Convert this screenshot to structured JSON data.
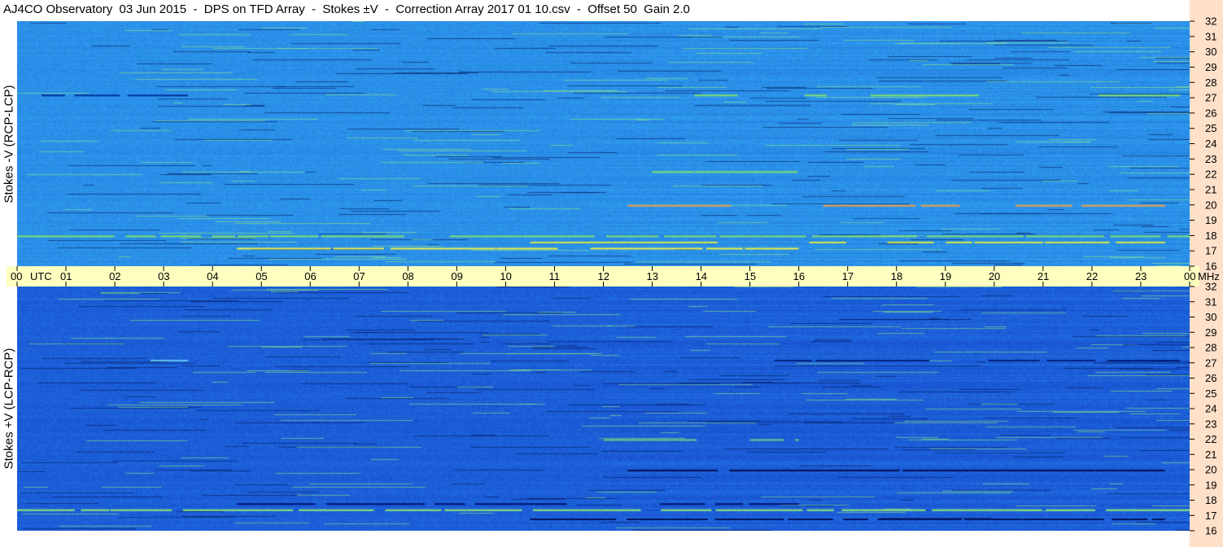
{
  "title": "AJ4CO Observatory  03 Jun 2015  -  DPS on TFD Array  -  Stokes ±V  -  Correction Array 2017 01 10.csv  -  Offset 50  Gain 2.0",
  "chart_data": [
    {
      "type": "heatmap",
      "panel": "top",
      "ylabel": "Stokes -V (RCP-LCP)",
      "x_range_utc_hours": [
        0,
        24
      ],
      "y_range_mhz": [
        16,
        32
      ],
      "y_ticks": [
        16,
        17,
        18,
        19,
        20,
        21,
        22,
        23,
        24,
        25,
        26,
        27,
        28,
        29,
        30,
        31,
        32
      ],
      "base_color": "#2a90e8",
      "features": [
        {
          "freq_mhz": 17.2,
          "start_utc": 4.5,
          "end_utc": 16.0,
          "color": "#f2f040"
        },
        {
          "freq_mhz": 17.6,
          "start_utc": 10.5,
          "end_utc": 23.5,
          "color": "#d8e840"
        },
        {
          "freq_mhz": 18.0,
          "start_utc": 0.0,
          "end_utc": 24.0,
          "color": "#80e070"
        },
        {
          "freq_mhz": 20.0,
          "start_utc": 12.5,
          "end_utc": 23.5,
          "color": "#f0a040"
        },
        {
          "freq_mhz": 22.2,
          "start_utc": 12.0,
          "end_utc": 16.0,
          "color": "#80e070"
        },
        {
          "freq_mhz": 27.2,
          "start_utc": 0.5,
          "end_utc": 3.5,
          "color": "#0030a0"
        },
        {
          "freq_mhz": 27.2,
          "start_utc": 12.8,
          "end_utc": 23.8,
          "color": "#80e070"
        }
      ]
    },
    {
      "type": "heatmap",
      "panel": "bottom",
      "ylabel": "Stokes +V (LCP-RCP)",
      "x_range_utc_hours": [
        0,
        24
      ],
      "y_range_mhz": [
        16,
        32
      ],
      "y_ticks": [
        16,
        17,
        18,
        19,
        20,
        21,
        22,
        23,
        24,
        25,
        26,
        27,
        28,
        29,
        30,
        31,
        32
      ],
      "base_color": "#1c5fd8",
      "features": [
        {
          "freq_mhz": 16.8,
          "start_utc": 10.5,
          "end_utc": 23.5,
          "color": "#001060"
        },
        {
          "freq_mhz": 17.4,
          "start_utc": 0.0,
          "end_utc": 24.0,
          "color": "#90e870"
        },
        {
          "freq_mhz": 17.8,
          "start_utc": 4.5,
          "end_utc": 16.0,
          "color": "#001070"
        },
        {
          "freq_mhz": 20.0,
          "start_utc": 12.5,
          "end_utc": 23.5,
          "color": "#001050"
        },
        {
          "freq_mhz": 22.0,
          "start_utc": 12.0,
          "end_utc": 16.0,
          "color": "#70d080"
        },
        {
          "freq_mhz": 27.2,
          "start_utc": 0.5,
          "end_utc": 3.5,
          "color": "#60c0f0"
        },
        {
          "freq_mhz": 27.2,
          "start_utc": 15.5,
          "end_utc": 23.8,
          "color": "#002080"
        }
      ]
    }
  ],
  "time_axis": {
    "ticks": [
      "00",
      "01",
      "02",
      "03",
      "04",
      "05",
      "06",
      "07",
      "08",
      "09",
      "10",
      "11",
      "12",
      "13",
      "14",
      "15",
      "16",
      "17",
      "18",
      "19",
      "20",
      "21",
      "22",
      "23",
      "00"
    ],
    "start_label": "UTC",
    "unit_label": "MHz"
  }
}
